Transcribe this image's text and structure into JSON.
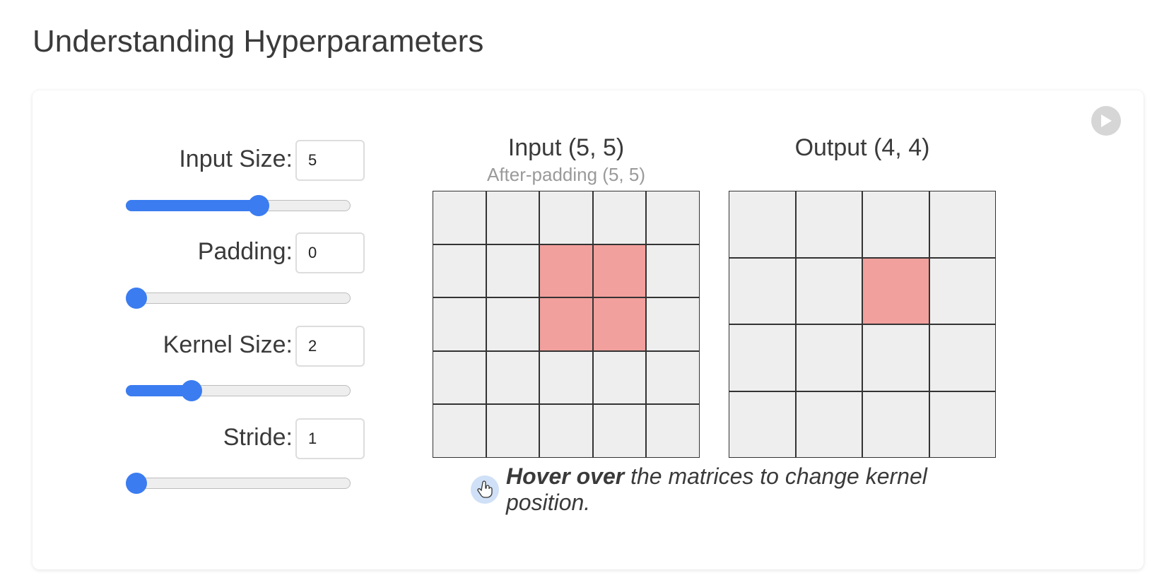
{
  "page": {
    "title": "Understanding Hyperparameters"
  },
  "controls": [
    {
      "label": "Input Size:",
      "value": "5",
      "slider_fraction": 0.6
    },
    {
      "label": "Padding:",
      "value": "0",
      "slider_fraction": 0.0
    },
    {
      "label": "Kernel Size:",
      "value": "2",
      "slider_fraction": 0.27
    },
    {
      "label": "Stride:",
      "value": "1",
      "slider_fraction": 0.0
    }
  ],
  "input_matrix": {
    "title": "Input (5, 5)",
    "subtitle": "After-padding (5, 5)",
    "rows": 5,
    "cols": 5,
    "kernel_row": 1,
    "kernel_col": 2,
    "kernel_size": 2
  },
  "output_matrix": {
    "title": "Output (4, 4)",
    "rows": 4,
    "cols": 4,
    "active_row": 1,
    "active_col": 2
  },
  "hint": {
    "bold": "Hover over",
    "rest": " the matrices to change kernel position."
  },
  "icons": {
    "play": "play-icon",
    "hint": "hand-pointer-icon"
  },
  "colors": {
    "accent": "#3b7cf0",
    "kernel": "#f2a09d",
    "cell": "#eeeeee"
  }
}
